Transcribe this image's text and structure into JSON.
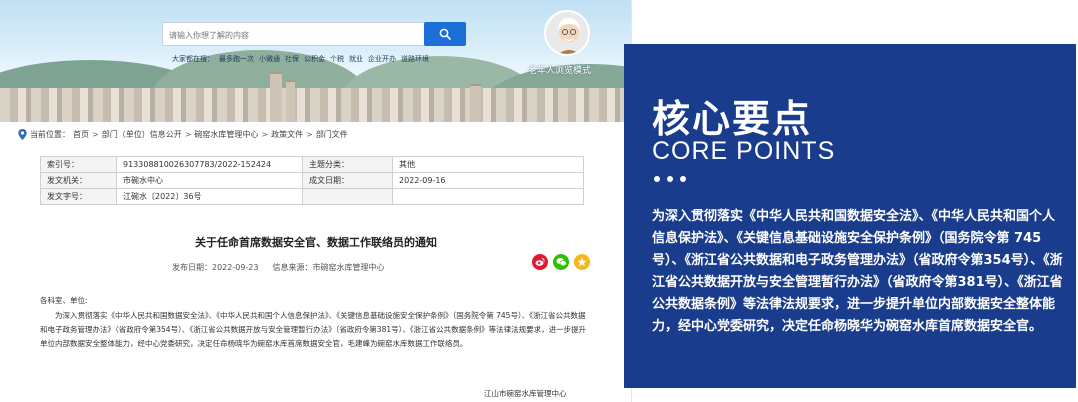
{
  "site": {
    "search": {
      "placeholder": "请输入你想了解的内容"
    },
    "hot_label": "大家都在搜：",
    "hot_terms": [
      "最多跑一次",
      "小微通",
      "社保",
      "公积金",
      "个税",
      "就业",
      "企业开办",
      "道路环境"
    ],
    "elder_mode_label": "老年人浏览模式",
    "breadcrumb": {
      "prefix": "当前位置：",
      "items": [
        "首页",
        "部门（单位）信息公开",
        "碗窑水库管理中心",
        "政策文件",
        "部门文件"
      ],
      "separator": ">"
    }
  },
  "meta_table": {
    "rows": [
      {
        "k1": "索引号：",
        "v1": "913308810026307783/2022-152424",
        "k2": "主题分类：",
        "v2": "其他"
      },
      {
        "k1": "发文机关：",
        "v1": "市碗水中心",
        "k2": "成文日期：",
        "v2": "2022-09-16"
      },
      {
        "k1": "发文字号：",
        "v1": "江碗水〔2022〕36号",
        "k2": "",
        "v2": ""
      }
    ]
  },
  "document": {
    "title": "关于任命首席数据安全官、数据工作联络员的通知",
    "publish_date": "发布日期：2022-09-23",
    "source": "信息来源：市碗窑水库管理中心",
    "salutation": "各科室、单位:",
    "paragraph": "为深入贯彻落实《中华人民共和国数据安全法》、《中华人民共和国个人信息保护法》、《关键信息基础设施安全保护条例》（国务院令第 745号）、《浙江省公共数据和电子政务管理办法》（省政府令第354号）、《浙江省公共数据开放与安全管理暂行办法》（省政府令第381号）、《浙江省公共数据条例》等法律法规要求，进一步提升单位内部数据安全整体能力，经中心党委研究，决定任命杨晓华为碗窑水库首席数据安全官，毛建峰为碗窑水库数据工作联络员。",
    "signature": "江山市碗窑水库管理中心"
  },
  "share_icons": [
    "weibo-icon",
    "wechat-icon",
    "favorite-icon"
  ],
  "panel": {
    "title": "核心要点",
    "subtitle": "CORE POINTS",
    "body": "为深入贯彻落实《中华人民共和国数据安全法》、《中华人民共和国个人信息保护法》、《关键信息基础设施安全保护条例》（国务院令第 745号）、《浙江省公共数据和电子政务管理办法》（省政府令第354号）、《浙江省公共数据开放与安全管理暂行办法》（省政府令第381号）、《浙江省公共数据条例》等法律法规要求，进一步提升单位内部数据安全整体能力，经中心党委研究，决定任命杨晓华为碗窑水库首席数据安全官。"
  },
  "colors": {
    "panel_bg": "#1a3c8c",
    "search_button": "#1b6fd6",
    "weibo": "#e6162d",
    "wechat": "#2dc100",
    "favorite": "#f5b81a"
  }
}
